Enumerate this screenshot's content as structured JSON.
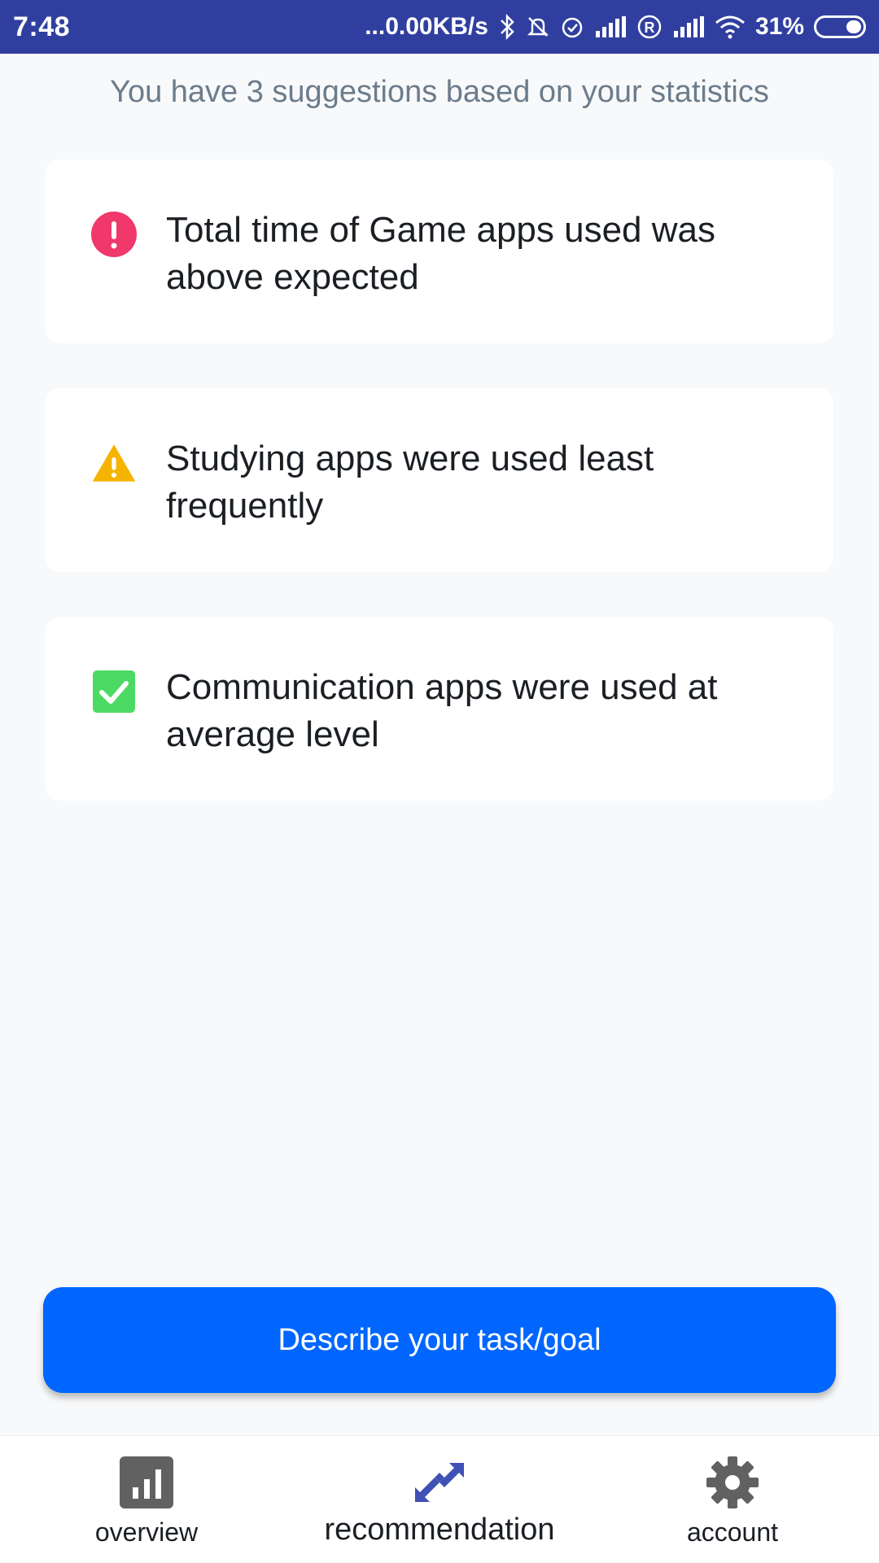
{
  "status_bar": {
    "time": "7:48",
    "network_speed": "...0.00KB/s",
    "battery_percent": "31%",
    "icons": [
      "bluetooth-icon",
      "silent-icon",
      "alarm-icon",
      "signal-icon",
      "roaming-icon",
      "signal-icon",
      "wifi-icon",
      "battery-icon"
    ]
  },
  "subtitle": "You have 3 suggestions based on your statistics",
  "suggestions": [
    {
      "icon": "error-icon",
      "color": "#f0386b",
      "text_line1": "Total time of Game apps used was",
      "text_line2": "above expected"
    },
    {
      "icon": "warning-icon",
      "color": "#f5b400",
      "text_line1": "Studying apps were used least",
      "text_line2": "frequently"
    },
    {
      "icon": "check-icon",
      "color": "#4cd964",
      "text_line1": "Communication apps were used at",
      "text_line2": "average level"
    }
  ],
  "cta": {
    "label": "Describe your task/goal",
    "color": "#0066ff"
  },
  "bottom_nav": {
    "items": [
      {
        "label": "overview",
        "icon": "bar-chart-icon"
      },
      {
        "label": "recommendation",
        "icon": "arrows-icon",
        "active": true
      },
      {
        "label": "account",
        "icon": "gear-icon"
      }
    ]
  }
}
